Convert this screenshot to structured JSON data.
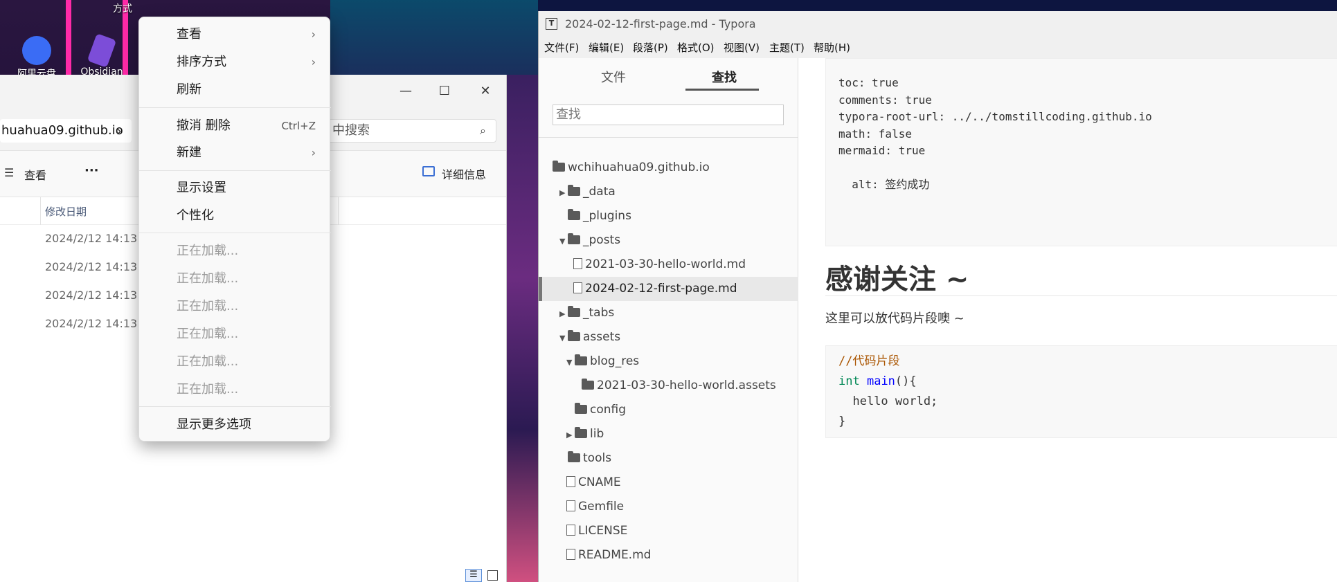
{
  "desktop": {
    "icons": [
      {
        "label": "阿里云盘"
      },
      {
        "label": "Obsidian"
      }
    ],
    "partial_labels": [
      "方式"
    ]
  },
  "explorer": {
    "crumb": "huahua09.github.io",
    "crumb_chevron": "›",
    "search_placeholder": "中搜索",
    "view_label": "查看",
    "more": "···",
    "details_label": "详细信息",
    "col_date": "修改日期",
    "rows": [
      "2024/2/12 14:13",
      "2024/2/12 14:13",
      "2024/2/12 14:13",
      "2024/2/12 14:13"
    ]
  },
  "menu": {
    "view": "查看",
    "sort": "排序方式",
    "refresh": "刷新",
    "undo": "撤消 删除",
    "undo_shortcut": "Ctrl+Z",
    "new": "新建",
    "display": "显示设置",
    "personalize": "个性化",
    "loading": [
      "正在加载...",
      "正在加载...",
      "正在加载...",
      "正在加载...",
      "正在加载...",
      "正在加载..."
    ],
    "more": "显示更多选项"
  },
  "typora": {
    "title": "2024-02-12-first-page.md - Typora",
    "menus": [
      "文件(F)",
      "编辑(E)",
      "段落(P)",
      "格式(O)",
      "视图(V)",
      "主题(T)",
      "帮助(H)"
    ],
    "tabs": {
      "files": "文件",
      "search": "查找"
    },
    "search_placeholder": "查找",
    "tree": [
      {
        "label": "wchihuahua09.github.io",
        "type": "folder"
      },
      {
        "label": "_data",
        "type": "folder"
      },
      {
        "label": "_plugins",
        "type": "folder"
      },
      {
        "label": "_posts",
        "type": "folder"
      },
      {
        "label": "2021-03-30-hello-world.md",
        "type": "file"
      },
      {
        "label": "2024-02-12-first-page.md",
        "type": "file",
        "selected": true
      },
      {
        "label": "_tabs",
        "type": "folder"
      },
      {
        "label": "assets",
        "type": "folder"
      },
      {
        "label": "blog_res",
        "type": "folder"
      },
      {
        "label": "2021-03-30-hello-world.assets",
        "type": "folder"
      },
      {
        "label": "config",
        "type": "folder"
      },
      {
        "label": "lib",
        "type": "folder"
      },
      {
        "label": "tools",
        "type": "folder"
      },
      {
        "label": "CNAME",
        "type": "file"
      },
      {
        "label": "Gemfile",
        "type": "file"
      },
      {
        "label": "LICENSE",
        "type": "file"
      },
      {
        "label": "README.md",
        "type": "file"
      }
    ],
    "front_matter": [
      "toc: true",
      "comments: true",
      "typora-root-url: ../../tomstillcoding.github.io",
      "math: false",
      "mermaid: true",
      "",
      "  alt: 签约成功"
    ],
    "heading": "感谢关注 ~",
    "paragraph": "这里可以放代码片段噢 ~",
    "code": {
      "comment": "//代码片段",
      "kw": "int",
      "fn": "main",
      "sig_rest": "(){",
      "line2": "  hello world;",
      "line3": "}"
    }
  },
  "colors": {
    "accent": "#333333",
    "keyword": "#008855",
    "function": "#0000ff",
    "comment": "#aa5500"
  }
}
